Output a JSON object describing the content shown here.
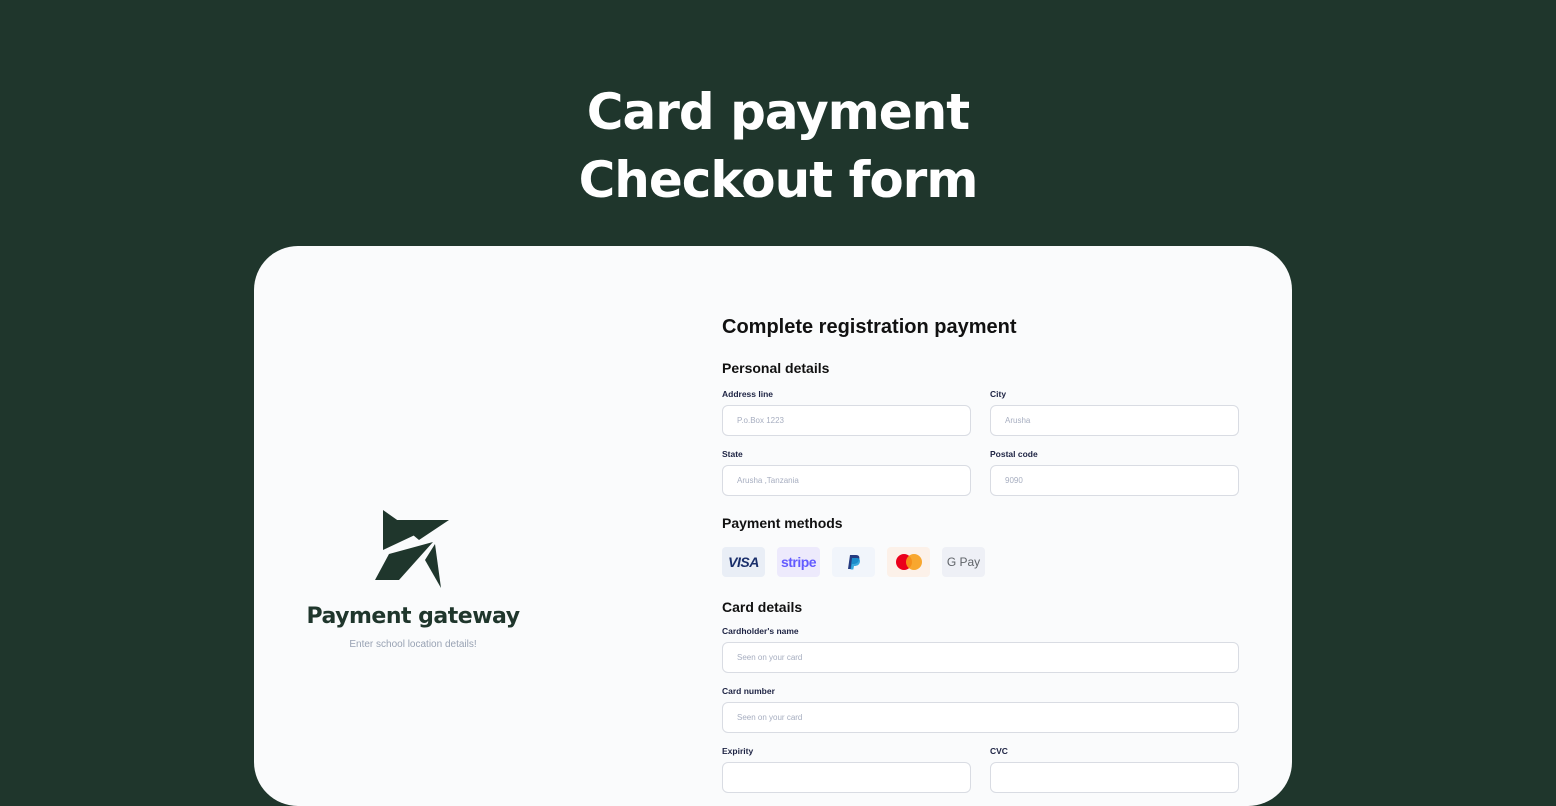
{
  "hero": {
    "title_line1": "Card payment",
    "title_line2": "Checkout  form"
  },
  "brand": {
    "name": "Payment gateway",
    "subtitle": "Enter school location details!",
    "color": "#1f362c"
  },
  "form": {
    "title": "Complete registration payment",
    "personal": {
      "heading": "Personal details",
      "address": {
        "label": "Address line",
        "placeholder": "P.o.Box 1223"
      },
      "city": {
        "label": "City",
        "placeholder": "Arusha"
      },
      "state": {
        "label": "State",
        "placeholder": "Arusha ,Tanzania"
      },
      "postal": {
        "label": "Postal code",
        "placeholder": "9090"
      }
    },
    "payment": {
      "heading": "Payment methods",
      "methods": [
        {
          "name": "visa",
          "label": "VISA"
        },
        {
          "name": "stripe",
          "label": "stripe"
        },
        {
          "name": "paypal",
          "label": ""
        },
        {
          "name": "mastercard",
          "label": ""
        },
        {
          "name": "google-pay",
          "label": "G Pay"
        }
      ]
    },
    "card": {
      "heading": "Card details",
      "holder": {
        "label": "Cardholder's name",
        "placeholder": "Seen on your card"
      },
      "number": {
        "label": "Card number",
        "placeholder": "Seen on your card"
      },
      "expiry": {
        "label": "Expirity",
        "placeholder": ""
      },
      "cvc": {
        "label": "CVC",
        "placeholder": ""
      }
    }
  },
  "colors": {
    "background": "#1f362c",
    "card": "#fafbfc",
    "accent": "#1f362c"
  }
}
